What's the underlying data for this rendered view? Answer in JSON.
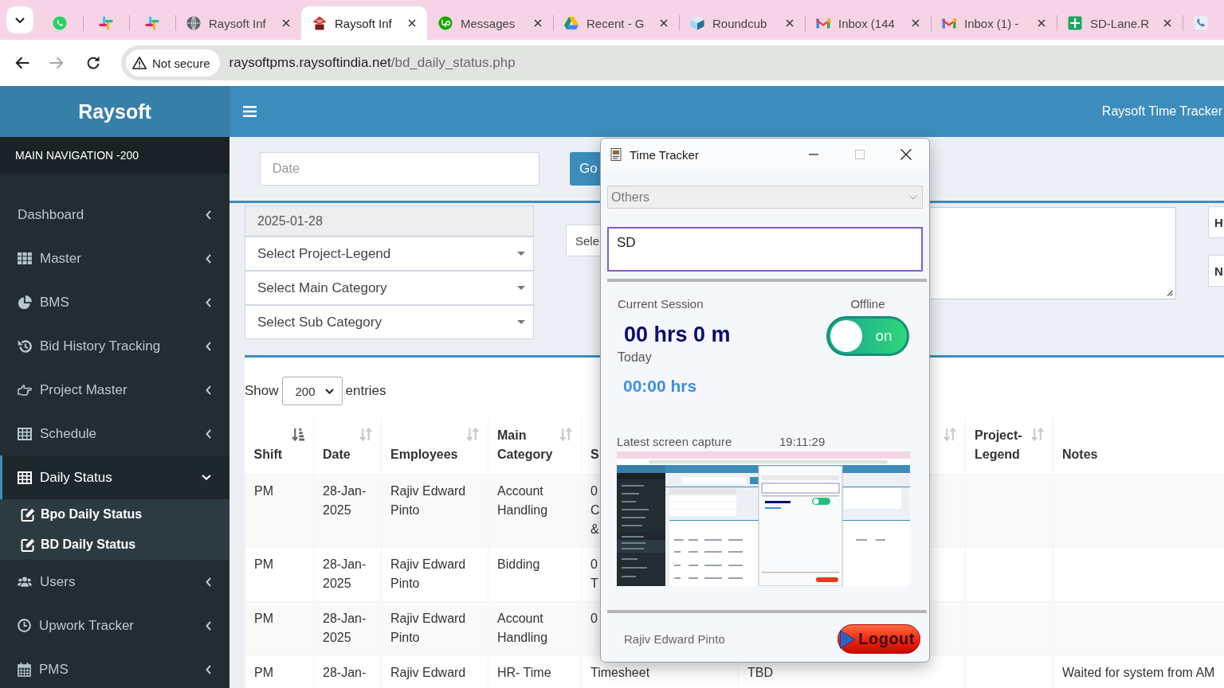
{
  "browser": {
    "tabs": [
      {
        "kind": "pinned",
        "selected": false
      },
      {
        "kind": "pinned",
        "selected": false
      },
      {
        "kind": "pinned",
        "selected": false
      },
      {
        "kind": "normal",
        "label": "Raysoft Inf",
        "selected": false
      },
      {
        "kind": "normal",
        "label": "Raysoft Inf",
        "selected": true
      },
      {
        "kind": "normal",
        "label": "Messages",
        "selected": false
      },
      {
        "kind": "normal",
        "label": "Recent - G",
        "selected": false
      },
      {
        "kind": "normal",
        "label": "Roundcub",
        "selected": false
      },
      {
        "kind": "normal",
        "label": "Inbox (144",
        "selected": false
      },
      {
        "kind": "normal",
        "label": "Inbox (1) -",
        "selected": false
      },
      {
        "kind": "normal",
        "label": "SD-Lane.R",
        "selected": false
      },
      {
        "kind": "normal",
        "selected": false
      }
    ],
    "nav_buttons": [
      {
        "kind": "back",
        "disabled": false
      },
      {
        "kind": "forward",
        "disabled": true
      },
      {
        "kind": "reload",
        "disabled": false
      }
    ],
    "address_bar": {
      "security": "Not secure",
      "host": "raysoftpms.raysoftindia.net",
      "path": "/bd_daily_status.php"
    }
  },
  "app": {
    "brand": "Raysoft",
    "title": "Raysoft Time Tracker"
  },
  "sidebar": {
    "heading": "MAIN NAVIGATION -200",
    "items": [
      {
        "label": "Dashboard",
        "selected": false,
        "expanded": false
      },
      {
        "label": "Master",
        "selected": false,
        "expanded": false
      },
      {
        "label": "BMS",
        "selected": false,
        "expanded": false
      },
      {
        "label": "Bid History Tracking",
        "selected": false,
        "expanded": false
      },
      {
        "label": "Project Master",
        "selected": false,
        "expanded": false
      },
      {
        "label": "Schedule",
        "selected": false,
        "expanded": false
      },
      {
        "label": "Daily Status",
        "selected": true,
        "expanded": true,
        "children": [
          {
            "label": "Bpo Daily Status"
          },
          {
            "label": "BD Daily Status"
          }
        ]
      },
      {
        "label": "Users",
        "selected": false,
        "expanded": false
      },
      {
        "label": "Upwork Tracker",
        "selected": false,
        "expanded": false
      },
      {
        "label": "PMS",
        "selected": false,
        "expanded": false
      }
    ]
  },
  "filters": {
    "date_field": {
      "placeholder": "Date"
    },
    "go_button": "Go"
  },
  "form": {
    "date_field": {
      "value": "2025-01-28",
      "readonly": true
    },
    "selects": [
      "Select Project-Legend",
      "Select Main Category",
      "Select Sub Category"
    ],
    "select_partial": "Sele",
    "side_fields": [
      "H",
      "N"
    ]
  },
  "table": {
    "length_menu": {
      "prefix": "Show",
      "value": "200",
      "suffix": "entries"
    },
    "columns": [
      {
        "label": "Shift",
        "sorted": true
      },
      {
        "label": "Date",
        "sorted": false
      },
      {
        "label": "Employees",
        "sorted": false
      },
      {
        "label": "Main Category",
        "sorted": false
      },
      {
        "label": "S"
      },
      {
        "sorted": false
      },
      {
        "label": "Project-Legend",
        "sorted": false
      },
      {
        "label": "Notes"
      }
    ],
    "rows": [
      {
        "shift": "PM",
        "date": "28-Jan-2025",
        "employees": "Rajiv Edward Pinto",
        "main_category": "Account Handling",
        "column_5": "0\nC\n&"
      },
      {
        "shift": "PM",
        "date": "28-Jan-2025",
        "employees": "Rajiv Edward Pinto",
        "main_category": "Bidding",
        "column_5": "0\nT"
      },
      {
        "shift": "PM",
        "date": "28-Jan-2025",
        "employees": "Rajiv Edward Pinto",
        "main_category": "Account Handling",
        "column_5": "0"
      },
      {
        "shift": "PM",
        "date": "28-Jan-",
        "employees": "Rajiv Edward",
        "main_category": "HR- Time",
        "column_5": "Timesheet",
        "column_6": "TBD",
        "notes": "Waited for system from AM"
      }
    ]
  },
  "time_tracker": {
    "title": "Time Tracker",
    "controls": [
      {
        "kind": "minimize",
        "disabled": false
      },
      {
        "kind": "maximize",
        "disabled": true
      },
      {
        "kind": "close",
        "disabled": false
      }
    ],
    "category": {
      "value": "Others",
      "disabled": true
    },
    "task": {
      "value": "SD"
    },
    "session": {
      "label": "Current Session",
      "value": "00 hrs 0 m"
    },
    "status": "Offline",
    "toggle": {
      "label": "on",
      "on": true
    },
    "today": {
      "label": "Today",
      "value": "00:00 hrs"
    },
    "capture": {
      "label": "Latest screen capture",
      "time": "19:11:29"
    },
    "user": "Rajiv Edward Pinto",
    "logout": "Logout"
  }
}
